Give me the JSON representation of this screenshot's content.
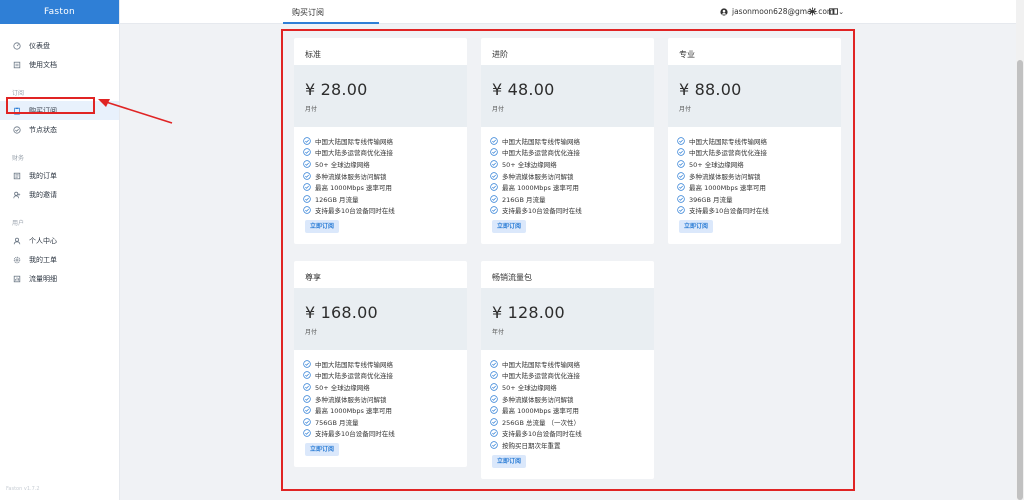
{
  "brand": "Faston",
  "page_title": "购买订阅",
  "user": {
    "email": "jasonmoon628@gmail.com"
  },
  "version": "Faston v1.7.2",
  "sidebar": {
    "items": [
      {
        "label": "仪表盘",
        "icon": "dashboard-icon"
      },
      {
        "label": "使用文档",
        "icon": "docs-icon"
      }
    ],
    "groups": [
      {
        "title": "订阅",
        "items": [
          {
            "label": "购买订阅",
            "icon": "clipboard-icon",
            "active": true
          },
          {
            "label": "节点状态",
            "icon": "check-circle-icon"
          }
        ]
      },
      {
        "title": "财务",
        "items": [
          {
            "label": "我的订单",
            "icon": "order-icon"
          },
          {
            "label": "我的邀请",
            "icon": "invite-icon"
          }
        ]
      },
      {
        "title": "用户",
        "items": [
          {
            "label": "个人中心",
            "icon": "user-icon"
          },
          {
            "label": "我的工单",
            "icon": "gear-icon"
          },
          {
            "label": "流量明细",
            "icon": "traffic-icon"
          }
        ]
      }
    ]
  },
  "plans": [
    {
      "name": "标准",
      "price": "¥ 28.00",
      "period": "月付",
      "button": "立即订阅",
      "features": [
        "中国大陆国际专线传输网络",
        "中国大陆多运营商优化连接",
        "50+ 全球边缘网络",
        "多种流媒体服务访问解锁",
        "最高 1000Mbps 速率可用",
        "126GB 月流量",
        "支持最多10台设备同时在线"
      ]
    },
    {
      "name": "进阶",
      "price": "¥ 48.00",
      "period": "月付",
      "button": "立即订阅",
      "features": [
        "中国大陆国际专线传输网络",
        "中国大陆多运营商优化连接",
        "50+ 全球边缘网络",
        "多种流媒体服务访问解锁",
        "最高 1000Mbps 速率可用",
        "216GB 月流量",
        "支持最多10台设备同时在线"
      ]
    },
    {
      "name": "专业",
      "price": "¥ 88.00",
      "period": "月付",
      "button": "立即订阅",
      "features": [
        "中国大陆国际专线传输网络",
        "中国大陆多运营商优化连接",
        "50+ 全球边缘网络",
        "多种流媒体服务访问解锁",
        "最高 1000Mbps 速率可用",
        "396GB 月流量",
        "支持最多10台设备同时在线"
      ]
    },
    {
      "name": "尊享",
      "price": "¥ 168.00",
      "period": "月付",
      "button": "立即订阅",
      "features": [
        "中国大陆国际专线传输网络",
        "中国大陆多运营商优化连接",
        "50+ 全球边缘网络",
        "多种流媒体服务访问解锁",
        "最高 1000Mbps 速率可用",
        "756GB 月流量",
        "支持最多10台设备同时在线"
      ]
    },
    {
      "name": "畅销流量包",
      "price": "¥ 128.00",
      "period": "年付",
      "button": "立即订阅",
      "features": [
        "中国大陆国际专线传输网络",
        "中国大陆多运营商优化连接",
        "50+ 全球边缘网络",
        "多种流媒体服务访问解锁",
        "最高 1000Mbps 速率可用",
        "256GB 总流量 （一次性）",
        "支持最多10台设备同时在线",
        "按购买日期次年重置"
      ]
    }
  ],
  "colors": {
    "accent": "#2f7fd6",
    "highlight": "#e02424",
    "price_bg": "#e9eef2"
  }
}
